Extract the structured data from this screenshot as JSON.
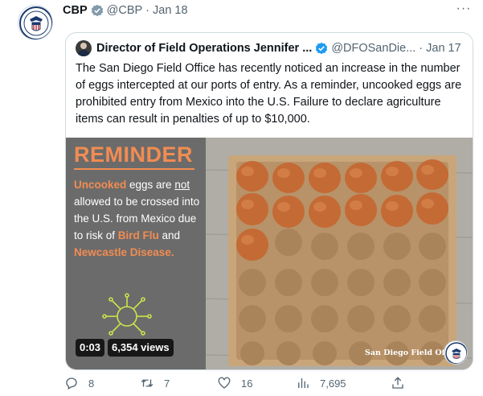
{
  "tweet": {
    "author": "CBP",
    "handle": "@CBP",
    "separator": "·",
    "date": "Jan 18",
    "more_label": "···"
  },
  "quote": {
    "author": "Director of Field Operations Jennifer ...",
    "handle": "@DFOSanDie...",
    "separator": "·",
    "date": "Jan 17",
    "text": "The San Diego Field Office has recently noticed an increase in the number of eggs intercepted at our ports of entry. As a reminder, uncooked eggs are prohibited entry from Mexico into the U.S. Failure to declare agriculture items can result in penalties of up to $10,000."
  },
  "media": {
    "heading": "REMINDER",
    "panel": {
      "w1": "Uncooked",
      "w2": " eggs are ",
      "w3": "not",
      "w4": " allowed to be crossed into the U.S. from Mexico due to risk of ",
      "w5": "Bird Flu",
      "w6": " and ",
      "w7": "Newcastle Disease."
    },
    "video_time": "0:03",
    "views": "6,354 views",
    "watermark": "San Diego Field Office"
  },
  "actions": {
    "replies": "8",
    "retweets": "7",
    "likes": "16",
    "views": "7,695"
  },
  "colors": {
    "accent_orange": "#f28c52",
    "verified_blue": "#1d9bf0",
    "verified_gray": "#829aab",
    "muted": "#536471"
  },
  "icons": [
    "verified-gray-icon",
    "verified-blue-icon",
    "reply-icon",
    "retweet-icon",
    "like-icon",
    "analytics-icon",
    "share-icon",
    "virus-icon",
    "seal-icon"
  ]
}
